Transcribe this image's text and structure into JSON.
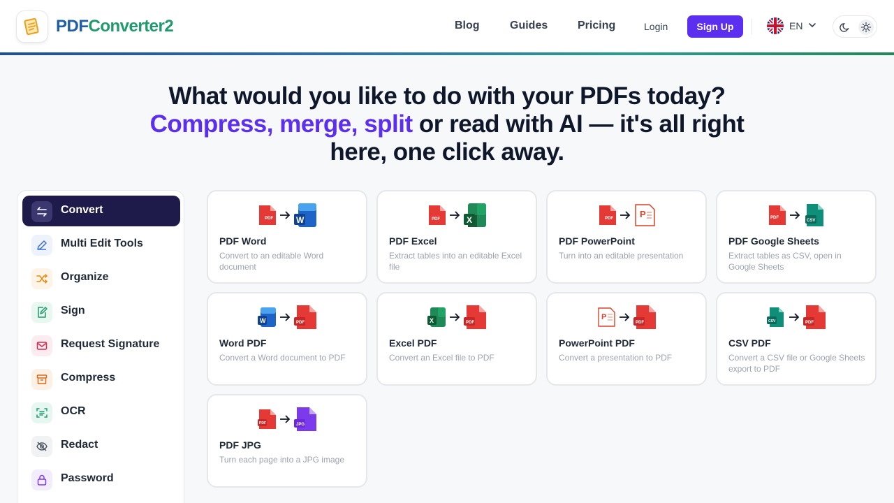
{
  "brand": {
    "name_part1": "PDF",
    "name_part2": "Converter2"
  },
  "nav": {
    "blog": "Blog",
    "guides": "Guides",
    "pricing": "Pricing",
    "login": "Login",
    "signup": "Sign Up",
    "language": "EN"
  },
  "hero": {
    "line1": "What would you like to do with your PDFs today?",
    "highlight": "Compress, merge, split",
    "line2_rest": " or read with AI — it's all right",
    "line3": "here, one click away."
  },
  "sidebar": {
    "items": [
      {
        "label": "Convert",
        "icon": "arrows-swap-icon"
      },
      {
        "label": "Multi Edit Tools",
        "icon": "pen-icon"
      },
      {
        "label": "Organize",
        "icon": "shuffle-icon"
      },
      {
        "label": "Sign",
        "icon": "signature-icon"
      },
      {
        "label": "Request Signature",
        "icon": "mail-icon"
      },
      {
        "label": "Compress",
        "icon": "archive-icon"
      },
      {
        "label": "OCR",
        "icon": "scan-text-icon"
      },
      {
        "label": "Redact",
        "icon": "eye-off-icon"
      },
      {
        "label": "Password",
        "icon": "lock-icon"
      }
    ]
  },
  "cards": [
    {
      "title": "PDF  Word",
      "desc": "Convert to an editable Word document"
    },
    {
      "title": "PDF  Excel",
      "desc": "Extract tables into an editable Excel file"
    },
    {
      "title": "PDF  PowerPoint",
      "desc": "Turn into an editable presentation"
    },
    {
      "title": "PDF  Google Sheets",
      "desc": "Extract tables as CSV, open in Google Sheets"
    },
    {
      "title": "Word  PDF",
      "desc": "Convert a Word document to PDF"
    },
    {
      "title": "Excel  PDF",
      "desc": "Convert an Excel file to PDF"
    },
    {
      "title": "PowerPoint  PDF",
      "desc": "Convert a presentation to PDF"
    },
    {
      "title": "CSV  PDF",
      "desc": "Convert a CSV file or Google Sheets export to PDF"
    },
    {
      "title": "PDF  JPG",
      "desc": "Turn each page into a JPG image"
    }
  ],
  "icon_labels": {
    "pdf": "PDF",
    "csv": "CSV",
    "jpg": "JPG",
    "word": "W",
    "excel": "X",
    "ppt": "P"
  },
  "colors": {
    "accent": "#5b2ef0",
    "active_sidebar": "#1e1b4b",
    "pdf_red": "#e53935",
    "word_blue": "#1e63c8",
    "excel_green": "#1f8a57",
    "csv_teal": "#0f8f7a",
    "jpg_purple": "#7c3aed"
  }
}
